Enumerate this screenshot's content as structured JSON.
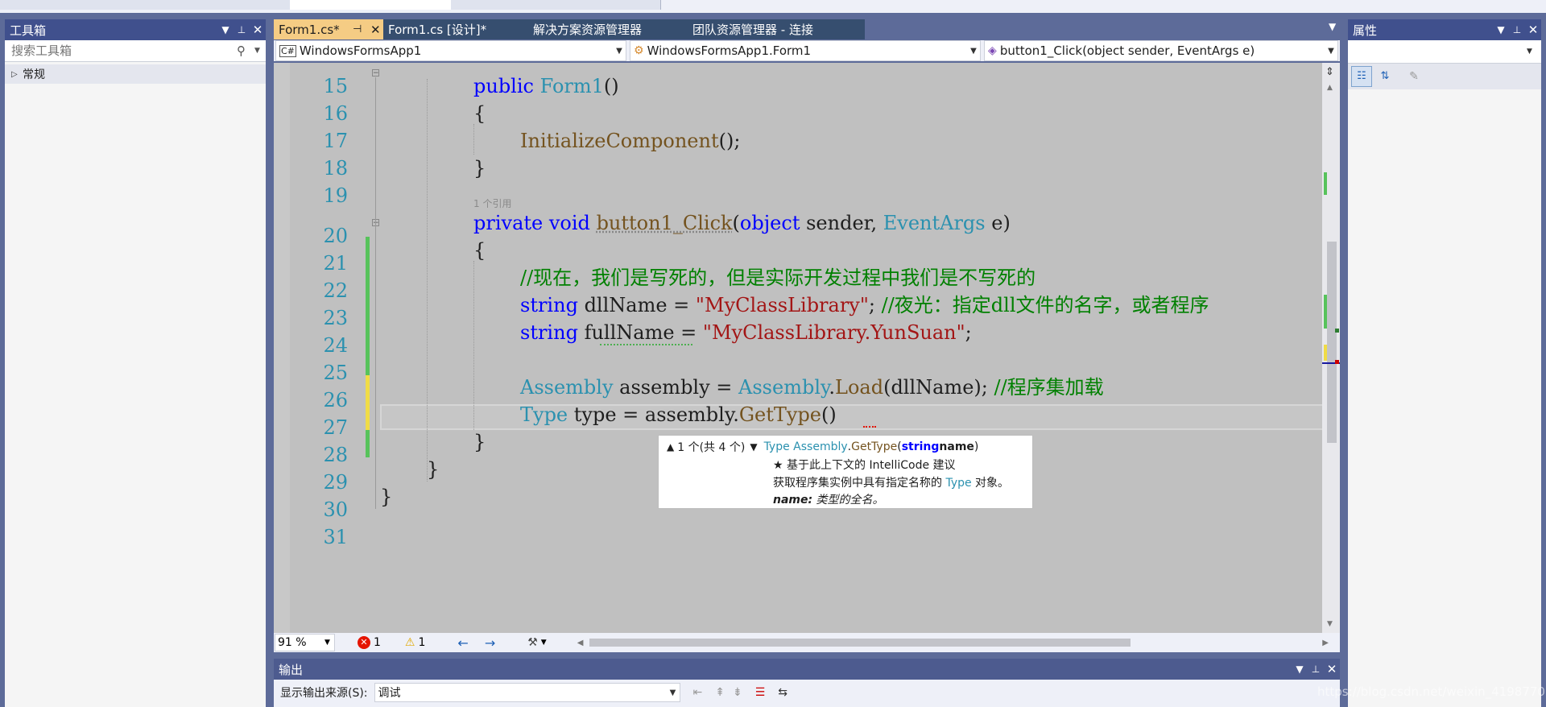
{
  "toolbox": {
    "title": "工具箱",
    "search_placeholder": "搜索工具箱",
    "group": "常规"
  },
  "tabs": [
    {
      "label": "Form1.cs*",
      "active": true
    },
    {
      "label": "Form1.cs [设计]*",
      "active": false
    },
    {
      "label": "解决方案资源管理器",
      "active": false
    },
    {
      "label": "团队资源管理器 - 连接",
      "active": false
    }
  ],
  "nav": {
    "project": "WindowsFormsApp1",
    "class": "WindowsFormsApp1.Form1",
    "member": "button1_Click(object sender, EventArgs e)"
  },
  "code": {
    "line_numbers": [
      "15",
      "16",
      "17",
      "18",
      "19",
      "20",
      "21",
      "22",
      "23",
      "24",
      "25",
      "26",
      "27",
      "28",
      "29",
      "30",
      "31"
    ],
    "codelens": "1 个引用",
    "l15": {
      "kw": "public",
      "name": "Form1",
      "rest": "()"
    },
    "l16": "{",
    "l17": {
      "name": "InitializeComponent",
      "rest": "();"
    },
    "l18": "}",
    "l20": {
      "kw1": "private",
      "kw2": "void",
      "name": "button1_Click",
      "p1": "(",
      "kw3": "object",
      "p2": " sender, ",
      "ty": "EventArgs",
      "p3": " e)"
    },
    "l21": "{",
    "l22": "//现在，我们是写死的，但是实际开发过程中我们是不写死的",
    "l23": {
      "kw": "string",
      "var": " dllName = ",
      "str": "\"MyClassLibrary\"",
      "p": "; ",
      "cm": "//夜光：指定dll文件的名字，或者程序"
    },
    "l24": {
      "kw": "string",
      "var": " fullName = ",
      "str": "\"MyClassLibrary.YunSuan\"",
      "p": ";"
    },
    "l26": {
      "ty1": "Assembly",
      "v1": " assembly = ",
      "ty2": "Assembly",
      "v2": ".",
      "mt": "Load",
      "v3": "(dllName); ",
      "cm": "//程序集加载"
    },
    "l27": {
      "ty": "Type",
      "v1": " type = assembly.",
      "mt": "GetType",
      "v2": "()"
    },
    "l28": "}",
    "l29": "}",
    "l30": "}"
  },
  "tooltip": {
    "counter": "1 个(共 4 个)",
    "sig_ret": "Type",
    "sig_cls": "Assembly",
    "sig_dot": ".",
    "sig_method": "GetType",
    "sig_open": "(",
    "sig_param_kw": "string",
    "sig_param": " name",
    "sig_close": ")",
    "star_line": "★ 基于此上下文的 IntelliCode 建议",
    "desc_pre": "获取程序集实例中具有指定名称的 ",
    "desc_type": "Type",
    "desc_post": " 对象。",
    "param_name": "name:",
    "param_desc": " 类型的全名。"
  },
  "status": {
    "zoom": "91 %",
    "errors": "1",
    "warnings": "1"
  },
  "properties": {
    "title": "属性"
  },
  "output": {
    "title": "输出",
    "source_label": "显示输出来源(S):",
    "source_value": "调试"
  },
  "watermark": "https://blog.csdn.net/weixin_41987706",
  "colors": {
    "accent_tab": "#f5cc84",
    "panel_header": "#40508d",
    "background": "#5d6b99",
    "editor_bg": "#c0c0c0"
  }
}
